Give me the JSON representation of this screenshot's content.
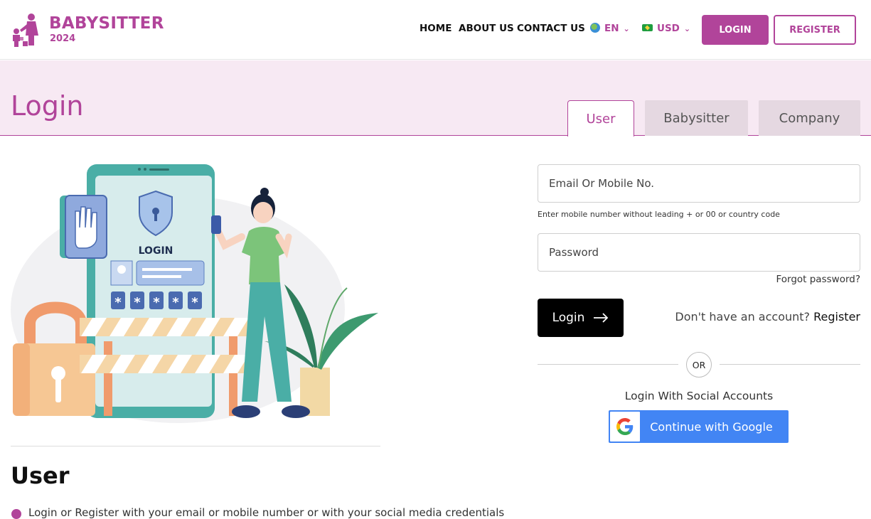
{
  "header": {
    "logo_line1": "BABYSITTER",
    "logo_line2": "2024",
    "nav": [
      "HOME",
      "ABOUT US",
      "CONTACT US"
    ],
    "language": "EN",
    "currency": "USD",
    "login_label": "LOGIN",
    "register_label": "REGISTER",
    "brand_color": "#b1449a"
  },
  "banner": {
    "title": "Login",
    "tabs": [
      "User",
      "Babysitter",
      "Company"
    ],
    "active_tab": "User"
  },
  "illustration": {
    "screen_label": "LOGIN",
    "pin_chars": [
      "*",
      "*",
      "*",
      "*",
      "*"
    ]
  },
  "form": {
    "email_placeholder": "Email Or Mobile No.",
    "email_hint": "Enter mobile number without leading + or 00 or country code",
    "password_placeholder": "Password",
    "forgot_label": "Forgot password?",
    "login_button": "Login",
    "no_account_text": "Don't have an account?",
    "register_link": "Register",
    "or_label": "OR",
    "social_label": "Login With Social Accounts",
    "google_button": "Continue with Google"
  },
  "section": {
    "heading": "User",
    "bullet_text": "Login or Register with your email or mobile number or with your social media credentials"
  }
}
